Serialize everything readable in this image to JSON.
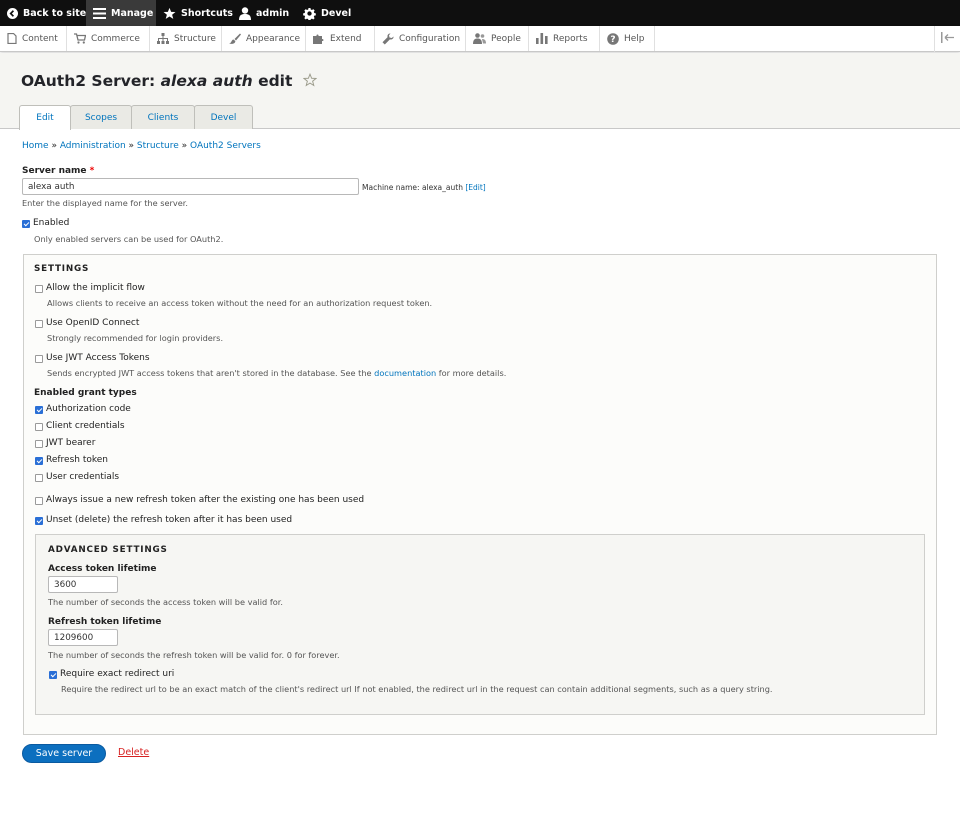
{
  "toolbar": {
    "back": "Back to site",
    "manage": "Manage",
    "shortcuts": "Shortcuts",
    "user": "admin",
    "devel": "Devel"
  },
  "tray": {
    "items": [
      "Content",
      "Commerce",
      "Structure",
      "Appearance",
      "Extend",
      "Configuration",
      "People",
      "Reports",
      "Help"
    ]
  },
  "page": {
    "title_prefix": "OAuth2 Server: ",
    "title_name": "alexa auth",
    "title_suffix": " edit"
  },
  "tabs": [
    "Edit",
    "Scopes",
    "Clients",
    "Devel"
  ],
  "breadcrumb": {
    "home": "Home",
    "sep": " » ",
    "administration": "Administration",
    "structure": "Structure",
    "oauth2_servers": "OAuth2 Servers"
  },
  "form": {
    "server_name_label": "Server name",
    "required_mark": "*",
    "server_name_value": "alexa auth",
    "machine_name_prefix": "Machine name: alexa_auth ",
    "machine_name_edit": "[Edit]",
    "server_name_desc": "Enter the displayed name for the server.",
    "enabled_label": "Enabled",
    "enabled_checked": true,
    "enabled_desc": "Only enabled servers can be used for OAuth2.",
    "settings_legend": "SETTINGS",
    "implicit_label": "Allow the implicit flow",
    "implicit_checked": false,
    "implicit_desc": "Allows clients to receive an access token without the need for an authorization request token.",
    "openid_label": "Use OpenID Connect",
    "openid_checked": false,
    "openid_desc": "Strongly recommended for login providers.",
    "jwt_label": "Use JWT Access Tokens",
    "jwt_checked": false,
    "jwt_desc_before": "Sends encrypted JWT access tokens that aren't stored in the database. See the ",
    "jwt_desc_link": "documentation",
    "jwt_desc_after": " for more details.",
    "grant_types_label": "Enabled grant types",
    "grant_types": [
      {
        "label": "Authorization code",
        "checked": true
      },
      {
        "label": "Client credentials",
        "checked": false
      },
      {
        "label": "JWT bearer",
        "checked": false
      },
      {
        "label": "Refresh token",
        "checked": true
      },
      {
        "label": "User credentials",
        "checked": false
      }
    ],
    "always_issue_label": "Always issue a new refresh token after the existing one has been used",
    "always_issue_checked": false,
    "unset_label": "Unset (delete) the refresh token after it has been used",
    "unset_checked": true,
    "advanced_legend": "ADVANCED SETTINGS",
    "access_lifetime_label": "Access token lifetime",
    "access_lifetime_value": "3600",
    "access_lifetime_desc": "The number of seconds the access token will be valid for.",
    "refresh_lifetime_label": "Refresh token lifetime",
    "refresh_lifetime_value": "1209600",
    "refresh_lifetime_desc": "The number of seconds the refresh token will be valid for. 0 for forever.",
    "exact_redirect_label": "Require exact redirect uri",
    "exact_redirect_checked": true,
    "exact_redirect_desc": "Require the redirect url to be an exact match of the client's redirect url If not enabled, the redirect url in the request can contain additional segments, such as a query string.",
    "save_label": "Save server",
    "delete_label": "Delete"
  },
  "colors": {
    "link": "#0074bd",
    "primary_button": "#0c6fbf",
    "delete": "#d72222",
    "toolbar_bg": "#0f0f0f",
    "checkbox_on": "#2a6fd6"
  },
  "icons": {
    "back": "back-arrow-icon",
    "manage": "hamburger-icon",
    "shortcuts": "star-icon",
    "user": "user-icon",
    "devel": "gear-icon"
  }
}
